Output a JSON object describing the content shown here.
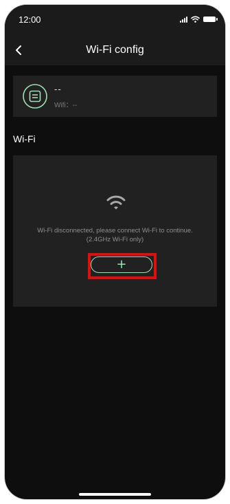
{
  "status_bar": {
    "time": "12:00",
    "icons": [
      "signal-icon",
      "wifi-icon",
      "battery-icon"
    ]
  },
  "nav": {
    "title": "Wi-Fi config",
    "back_icon": "chevron-left-icon"
  },
  "device": {
    "icon": "device-icon",
    "name": "--",
    "wifi_label": "Wifi：--"
  },
  "wifi_section": {
    "title": "Wi-Fi",
    "icon": "wifi-icon",
    "message_line1": "Wi-Fi disconnected, please connect Wi-Fi to continue.",
    "message_line2": "(2.4GHz Wi-Fi only)",
    "add_label": "+"
  },
  "colors": {
    "background": "#0e0e0e",
    "card": "#212121",
    "accent": "#9fe0b5",
    "highlight": "#e10e0e"
  }
}
